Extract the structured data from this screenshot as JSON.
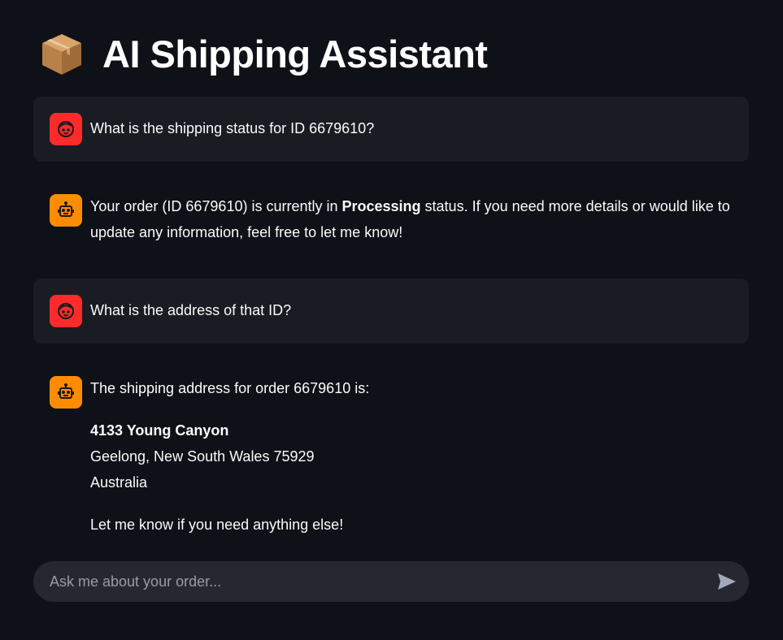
{
  "header": {
    "icon": "package-box-icon",
    "title": "AI Shipping Assistant"
  },
  "colors": {
    "background": "#0e1117",
    "user_bubble": "#1a1c23",
    "user_avatar": "#ff2b2b",
    "bot_avatar": "#ff8c00",
    "input_bg": "#262730"
  },
  "messages": [
    {
      "role": "user",
      "avatar_icon": "user-face-icon",
      "text": "What is the shipping status for ID 6679610?"
    },
    {
      "role": "assistant",
      "avatar_icon": "robot-icon",
      "text_before": "Your order (ID 6679610) is currently in ",
      "text_bold": "Processing",
      "text_after": " status. If you need more details or would like to update any information, feel free to let me know!"
    },
    {
      "role": "user",
      "avatar_icon": "user-face-icon",
      "text": "What is the address of that ID?"
    },
    {
      "role": "assistant",
      "avatar_icon": "robot-icon",
      "intro": "The shipping address for order 6679610 is:",
      "address_street": "4133 Young Canyon",
      "address_city": "Geelong, New South Wales 75929",
      "address_country": "Australia",
      "closing": "Let me know if you need anything else!"
    }
  ],
  "chat_input": {
    "placeholder": "Ask me about your order...",
    "value": "",
    "send_icon": "send-icon"
  }
}
